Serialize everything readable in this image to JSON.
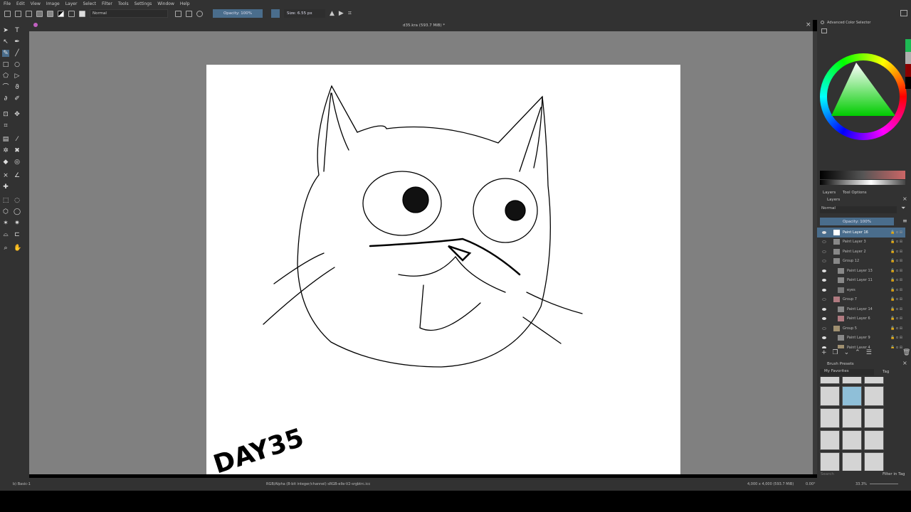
{
  "menu": [
    "File",
    "Edit",
    "View",
    "Image",
    "Layer",
    "Select",
    "Filter",
    "Tools",
    "Settings",
    "Window",
    "Help"
  ],
  "toolbar": {
    "blend_mode": "Normal",
    "opacity": "Opacity: 100%",
    "size": "Size: 6.55 px"
  },
  "document": {
    "title": "d35.kra (593.7 MiB) *",
    "drawing_text": "DAY35"
  },
  "color_selector": {
    "title": "Advanced Color Selector",
    "history_colors": [
      "#1db954",
      "#b0b0b0",
      "#8b0000",
      "#000000"
    ]
  },
  "layers_panel": {
    "tabs": [
      "Layers",
      "Tool Options"
    ],
    "title": "Layers",
    "blend_mode": "Normal",
    "opacity": "Opacity: 100%",
    "layers": [
      {
        "name": "Paint Layer 16",
        "visible": true,
        "selected": true,
        "indent": 0,
        "color": "#ffffff"
      },
      {
        "name": "Paint Layer 3",
        "visible": false,
        "indent": 0,
        "color": "#888888"
      },
      {
        "name": "Paint Layer 2",
        "visible": false,
        "indent": 0,
        "color": "#888888"
      },
      {
        "name": "Group 12",
        "visible": false,
        "indent": 0,
        "color": "#888888"
      },
      {
        "name": "Paint Layer 13",
        "visible": true,
        "indent": 1,
        "color": "#888888"
      },
      {
        "name": "Paint Layer 11",
        "visible": true,
        "indent": 1,
        "color": "#888888"
      },
      {
        "name": "eyes",
        "visible": true,
        "indent": 1,
        "color": "#777777"
      },
      {
        "name": "Group 7",
        "visible": false,
        "indent": 0,
        "color": "#b07a80"
      },
      {
        "name": "Paint Layer 14",
        "visible": true,
        "indent": 1,
        "color": "#888888"
      },
      {
        "name": "Paint Layer 6",
        "visible": true,
        "indent": 1,
        "color": "#b07a80"
      },
      {
        "name": "Group 5",
        "visible": false,
        "indent": 0,
        "color": "#a09070"
      },
      {
        "name": "Paint Layer 9",
        "visible": true,
        "indent": 1,
        "color": "#888888"
      },
      {
        "name": "Paint Layer 4",
        "visible": true,
        "indent": 1,
        "color": "#a09070"
      }
    ]
  },
  "brush_presets": {
    "title": "Brush Presets",
    "tag": "My Favorites",
    "tag_button": "Tag",
    "search_placeholder": "Search",
    "filter_in_tag": "Filter in Tag"
  },
  "status": {
    "brush": "b) Basic-1",
    "color_space": "RGB/Alpha (8-bit integer/channel)  sRGB-elle-V2-srgbtrc.icc",
    "dimensions": "4,000 x 4,000 (593.7 MiB)",
    "rotation": "0.00°",
    "zoom": "33.3%"
  }
}
